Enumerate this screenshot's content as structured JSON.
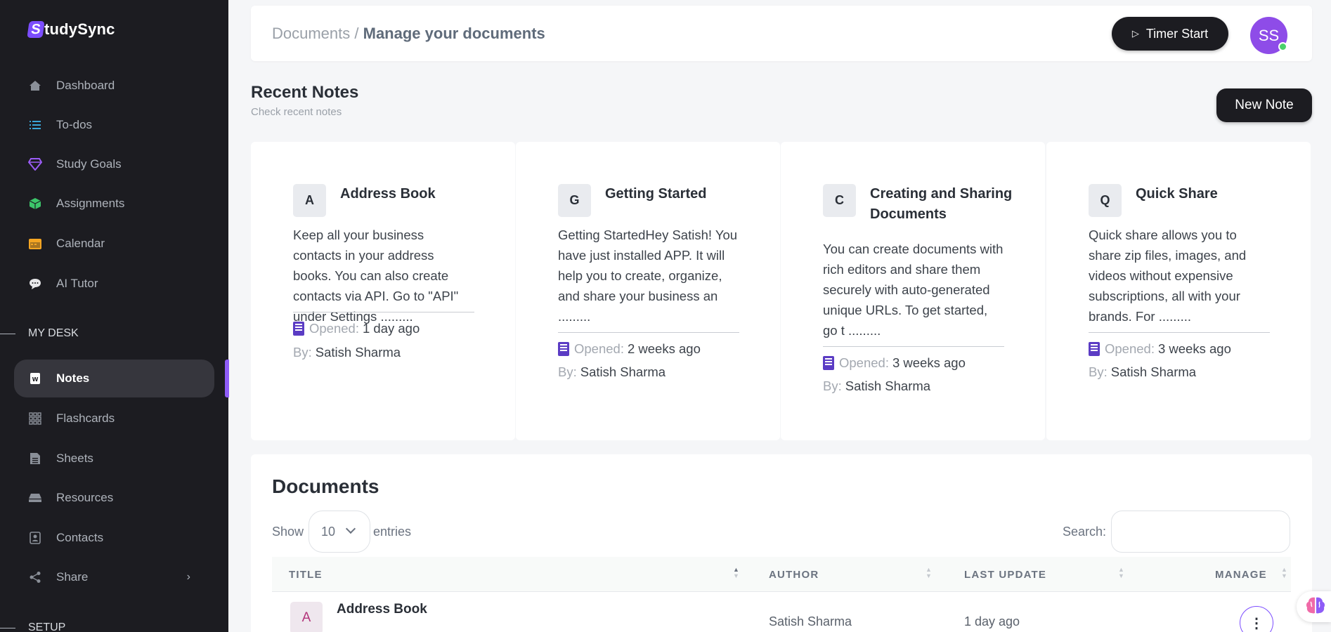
{
  "app": {
    "brand_letter": "S",
    "brand_rest": "tudySync"
  },
  "sidebar": {
    "items": [
      {
        "label": "Dashboard",
        "icon": "home-icon"
      },
      {
        "label": "To-dos",
        "icon": "list-icon"
      },
      {
        "label": "Study Goals",
        "icon": "diamond-icon"
      },
      {
        "label": "Assignments",
        "icon": "cube-icon"
      },
      {
        "label": "Calendar",
        "icon": "calendar-icon"
      },
      {
        "label": "AI Tutor",
        "icon": "chat-icon"
      }
    ],
    "section_my_desk": "MY DESK",
    "desk_items": [
      {
        "label": "Notes",
        "icon": "note-icon",
        "active": true
      },
      {
        "label": "Flashcards",
        "icon": "grid-icon"
      },
      {
        "label": "Sheets",
        "icon": "sheet-icon"
      },
      {
        "label": "Resources",
        "icon": "drive-icon"
      },
      {
        "label": "Contacts",
        "icon": "contact-icon"
      },
      {
        "label": "Share",
        "icon": "share-icon"
      }
    ],
    "section_setup": "SETUP",
    "accent_color": "#8e5cf7"
  },
  "header": {
    "breadcrumb_parent": "Documents",
    "breadcrumb_sep": " / ",
    "breadcrumb_current": "Manage your documents",
    "timer_label": "Timer Start",
    "avatar_initials": "SS"
  },
  "recent": {
    "title": "Recent Notes",
    "subtitle": "Check recent notes",
    "new_note_label": "New Note",
    "opened_label": "Opened:",
    "by_label": "By:",
    "notes": [
      {
        "letter": "A",
        "title": "Address Book",
        "body": "Keep all your business contacts in your address books. You can also create contacts via API. Go to \"API\" under Settings .........",
        "opened": "1 day ago",
        "author": "Satish Sharma"
      },
      {
        "letter": "G",
        "title": "Getting Started",
        "body": "Getting StartedHey Satish! You have just installed APP. It will help you to create, organize, and share your business an .........",
        "opened": "2 weeks ago",
        "author": "Satish Sharma"
      },
      {
        "letter": "C",
        "title": "Creating and Sharing Documents",
        "body": "You can create documents with rich editors and share them securely with auto-generated unique URLs. To get started, go t .........",
        "opened": "3 weeks ago",
        "author": "Satish Sharma"
      },
      {
        "letter": "Q",
        "title": "Quick Share",
        "body": "Quick share allows you to share zip files, images, and videos without expensive subscriptions, all with your brands. For .........",
        "opened": "3 weeks ago",
        "author": "Satish Sharma"
      }
    ]
  },
  "documents": {
    "title": "Documents",
    "show_label": "Show",
    "entries_value": "10",
    "entries_label": "entries",
    "search_label": "Search:",
    "search_value": "",
    "columns": [
      "TITLE",
      "AUTHOR",
      "LAST UPDATE",
      "MANAGE"
    ],
    "rows": [
      {
        "letter": "A",
        "title": "Address Book",
        "author": "Satish Sharma",
        "last_update": "1 day ago"
      }
    ]
  }
}
